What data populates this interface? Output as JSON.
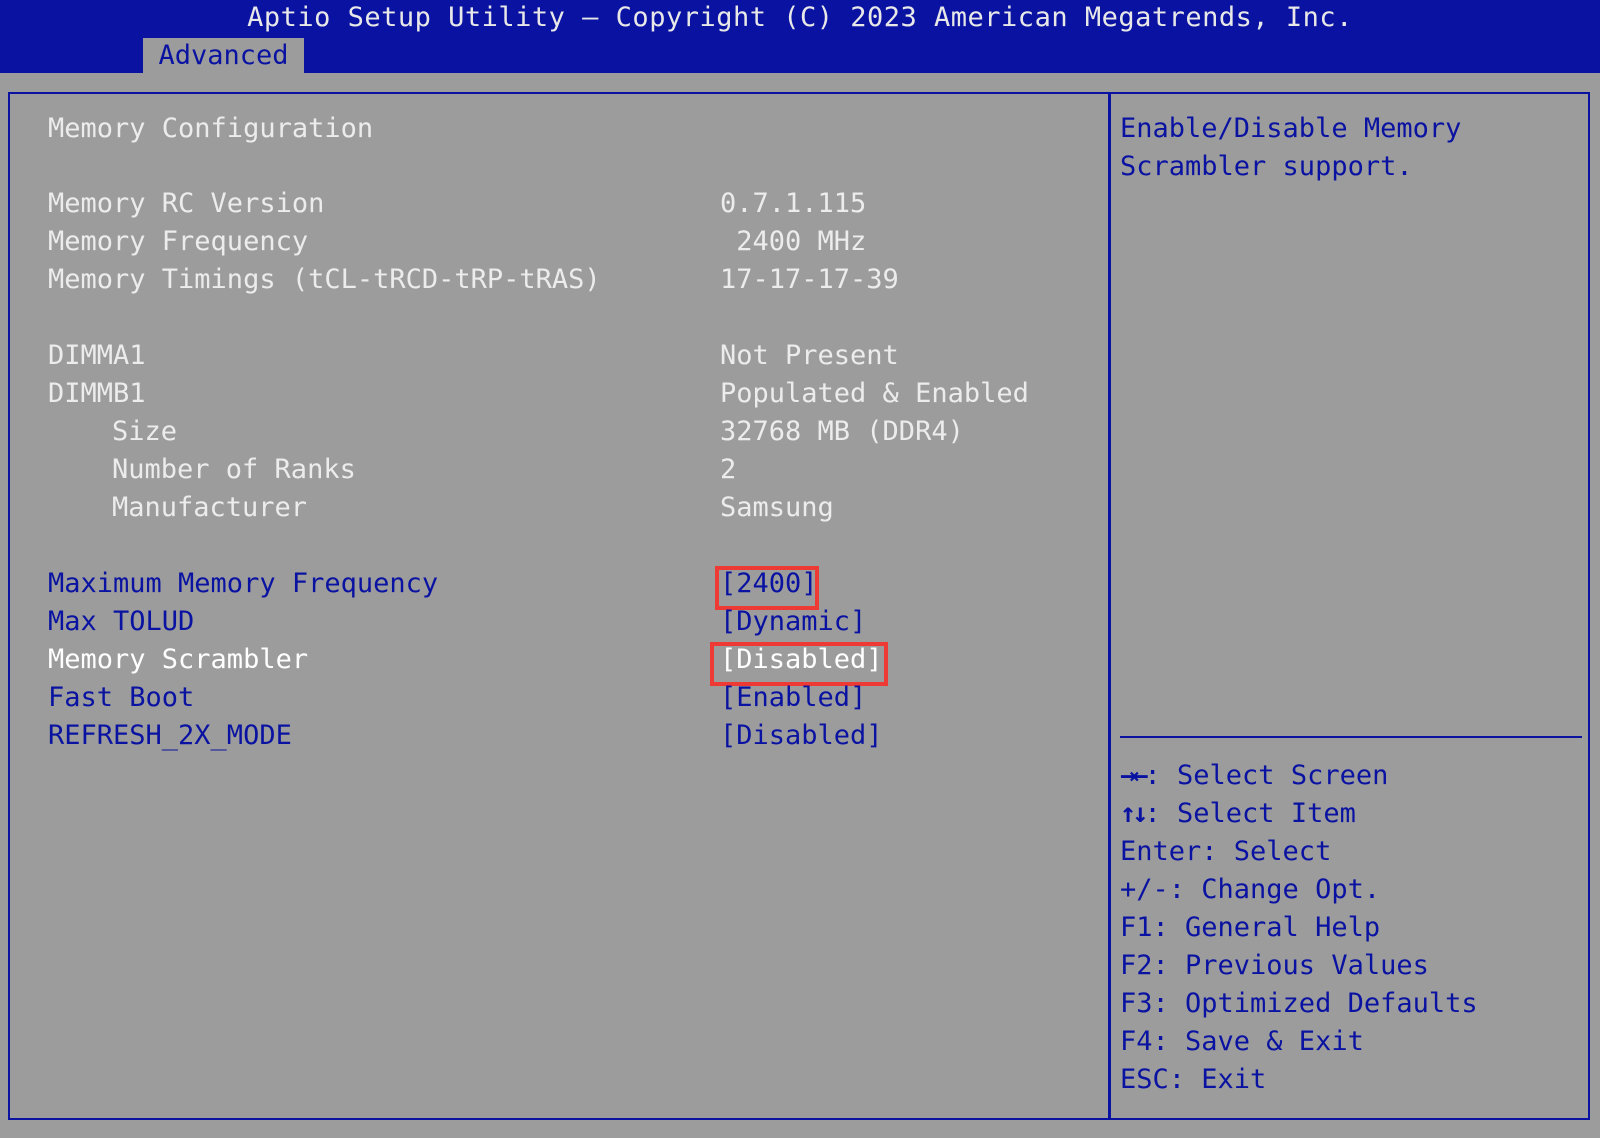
{
  "header": {
    "title": "Aptio Setup Utility – Copyright (C) 2023 American Megatrends, Inc.",
    "tabs": [
      {
        "label": "Advanced",
        "active": true
      }
    ]
  },
  "page": {
    "title": "Memory Configuration",
    "info_rows": [
      {
        "label": "Memory RC Version",
        "value": "0.7.1.115"
      },
      {
        "label": "Memory Frequency",
        "value": " 2400 MHz"
      },
      {
        "label": "Memory Timings (tCL-tRCD-tRP-tRAS)",
        "value": "17-17-17-39"
      },
      {
        "label": "DIMMA1",
        "value": "Not Present"
      },
      {
        "label": "DIMMB1",
        "value": "Populated & Enabled"
      },
      {
        "label": "Size",
        "value": "32768 MB (DDR4)"
      },
      {
        "label": "Number of Ranks",
        "value": "2"
      },
      {
        "label": "Manufacturer",
        "value": "Samsung"
      }
    ],
    "options": [
      {
        "label": "Maximum Memory Frequency",
        "value": "[2400]"
      },
      {
        "label": "Max TOLUD",
        "value": "[Dynamic]"
      },
      {
        "label": "Memory Scrambler",
        "value": "[Disabled]"
      },
      {
        "label": "Fast Boot",
        "value": "[Enabled]"
      },
      {
        "label": "REFRESH_2X_MODE",
        "value": "[Disabled]"
      }
    ]
  },
  "help": {
    "description_lines": [
      "Enable/Disable Memory",
      "Scrambler support."
    ],
    "keys": [
      {
        "key": "→←",
        "text": ": Select Screen"
      },
      {
        "key": "↑↓",
        "text": ": Select Item"
      },
      {
        "key": "",
        "text": "Enter: Select"
      },
      {
        "key": "",
        "text": "+/-: Change Opt."
      },
      {
        "key": "",
        "text": "F1: General Help"
      },
      {
        "key": "",
        "text": "F2: Previous Values"
      },
      {
        "key": "",
        "text": "F3: Optimized Defaults"
      },
      {
        "key": "",
        "text": "F4: Save & Exit"
      },
      {
        "key": "",
        "text": "ESC: Exit"
      }
    ]
  },
  "colors": {
    "background": "#9c9c9c",
    "header": "#0a13a1",
    "accent_text": "#0a13a1",
    "static_text": "#ececec",
    "highlight_box": "#ee3a35"
  }
}
